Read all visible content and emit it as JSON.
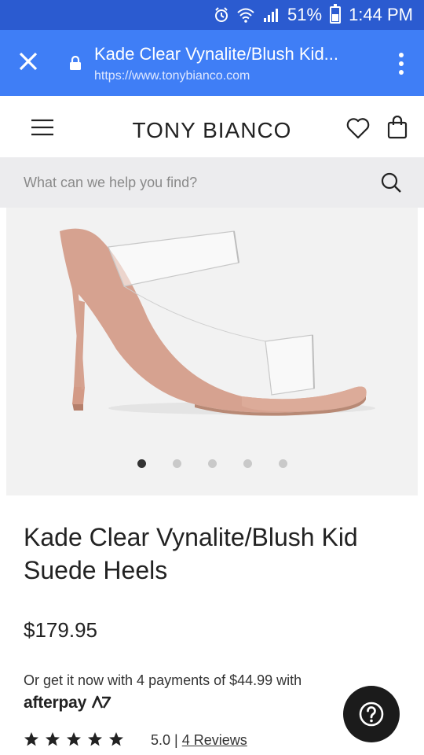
{
  "status_bar": {
    "battery": "51%",
    "time": "1:44 PM",
    "battery_level": 0.51
  },
  "browser": {
    "title": "Kade Clear Vynalite/Blush Kid...",
    "url": "https://www.tonybianco.com"
  },
  "header": {
    "logo": "TONY BIANCO"
  },
  "search": {
    "placeholder": "What can we help you find?"
  },
  "gallery": {
    "image_count": 5,
    "active_index": 0
  },
  "product": {
    "title": "Kade Clear Vynalite/Blush Kid Suede Heels",
    "price": "$179.95",
    "afterpay_text": "Or get it now with 4 payments of $44.99 with",
    "afterpay_logo": "afterpay",
    "rating": "5.0",
    "rating_separator": "|",
    "reviews_link": "4 Reviews",
    "stars": 5
  },
  "colors": {
    "status_bar": "#2b5bd0",
    "browser_bar": "#3f7ef6",
    "shoe_suede": "#d8a391",
    "help_button": "#1b1b1b"
  },
  "icons": {
    "close": "close-icon",
    "lock": "lock-icon",
    "menu": "more-vert-icon",
    "hamburger": "hamburger-icon",
    "wishlist": "heart-icon",
    "bag": "bag-icon",
    "search": "search-icon",
    "help": "question-icon",
    "star": "star-icon"
  }
}
